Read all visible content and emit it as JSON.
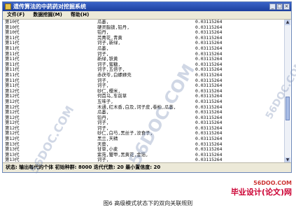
{
  "window": {
    "title": "遗传算法的中药药对挖掘系统",
    "controls": [
      "_",
      "□",
      "×"
    ]
  },
  "menu": [
    "文件(F)",
    "数据挖掘(M)",
    "帮助(H)"
  ],
  "rows": [
    {
      "gen": "第10代",
      "herb": "瓜蒌,",
      "val": "0.03115264"
    },
    {
      "gen": "第10代",
      "herb": "硬灵脂锁,铅丹,",
      "val": "0.03115264"
    },
    {
      "gen": "第10代",
      "herb": "铅丹,",
      "val": "0.03115264"
    },
    {
      "gen": "第11代",
      "herb": "芫菁花,青黄",
      "val": "0.03115264"
    },
    {
      "gen": "第11代",
      "herb": "诃子,新绿,",
      "val": "0.03115264"
    },
    {
      "gen": "第11代",
      "herb": "瓜蒌,",
      "val": "0.03115264"
    },
    {
      "gen": "第11代",
      "herb": "诃子,",
      "val": "0.03115264"
    },
    {
      "gen": "第11代",
      "herb": "新绿,铁黄",
      "val": "0.03115264"
    },
    {
      "gen": "第11代",
      "herb": "诃子,蜜糖,",
      "val": "0.03115264"
    },
    {
      "gen": "第11代",
      "herb": "诃子,五倍子,",
      "val": "0.03115264"
    },
    {
      "gen": "第11代",
      "herb": "赤茯苓,白螺蛳壳",
      "val": "0.03115264"
    },
    {
      "gen": "第11代",
      "herb": "诃子,",
      "val": "0.03115264"
    },
    {
      "gen": "第11代",
      "herb": "诃子,",
      "val": "0.03115264"
    },
    {
      "gen": "第12代",
      "herb": "砂仁,樱米,",
      "val": "0.03115264"
    },
    {
      "gen": "第12代",
      "herb": "何首乌,车前草",
      "val": "0.03115264"
    },
    {
      "gen": "第12代",
      "herb": "五味子,",
      "val": "0.03115264"
    },
    {
      "gen": "第12代",
      "herb": "木通,红木香,白及,诃子皮,卷柏,瓜蒌,",
      "val": "0.03115264"
    },
    {
      "gen": "第12代",
      "herb": "瓜蒌,",
      "val": "0.03115264"
    },
    {
      "gen": "第12代",
      "herb": "铅丹,",
      "val": "0.03115264"
    },
    {
      "gen": "第12代",
      "herb": "诃子,",
      "val": "0.03115264"
    },
    {
      "gen": "第12代",
      "herb": "诃子,",
      "val": "0.03115264"
    },
    {
      "gen": "第12代",
      "herb": "砂仁,白芍,黑丝子,没食子,",
      "val": "0.03115264"
    },
    {
      "gen": "第12代",
      "herb": "黑兰,天精",
      "val": "0.03115264"
    },
    {
      "gen": "第13代",
      "herb": "天葵,",
      "val": "0.03115264"
    },
    {
      "gen": "第13代",
      "herb": "甘草,小麦",
      "val": "0.03115264"
    },
    {
      "gen": "第13代",
      "herb": "紫苑,蟹甲,黑黄花,金箔,",
      "val": "0.03115264"
    },
    {
      "gen": "第13代",
      "herb": "诃子,",
      "val": "0.03115264"
    },
    {
      "gen": "第13代",
      "herb": "芦荟,石斛",
      "val": "0.03115264"
    },
    {
      "gen": "第13代",
      "herb": "白附子,铅丹,",
      "val": "0.03115264"
    }
  ],
  "status": "状态: 输出每代的个体 初始种群: 8000 迭代代数: 20 最小置信度: 20",
  "caption": "图6   高级模式状态下的双向关联规则",
  "watermarks": [
    "56DOC.COM",
    "56DOC.COM",
    "56DOC.COM"
  ],
  "logo": {
    "url": "56DOO.COM",
    "text": "毕业设计(论文)网"
  }
}
